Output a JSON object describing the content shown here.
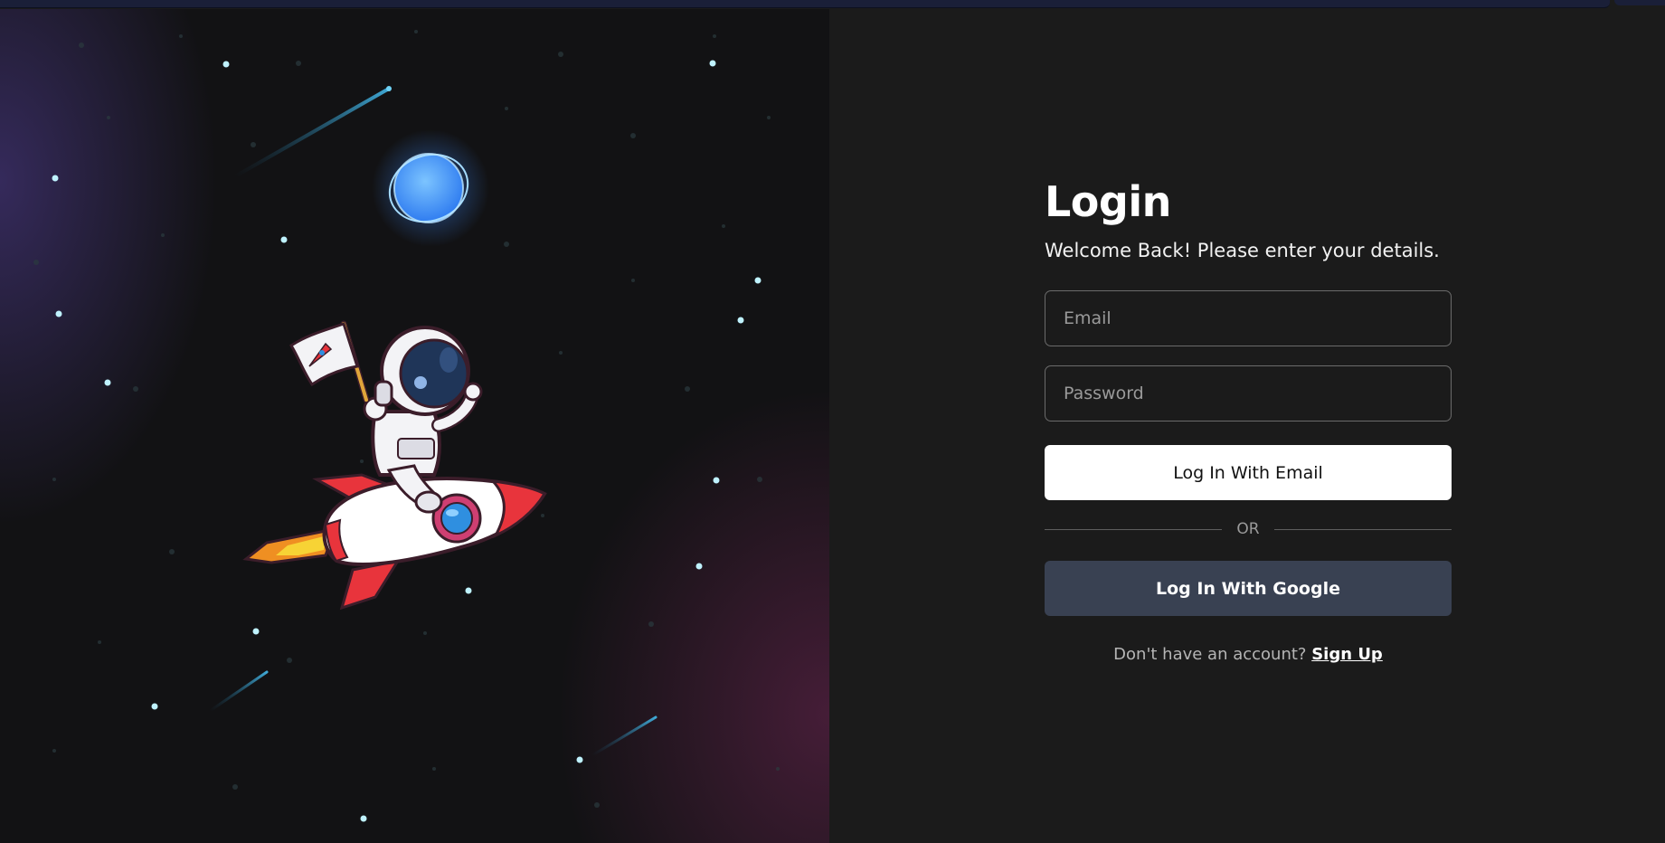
{
  "login": {
    "title": "Login",
    "subtitle": "Welcome Back! Please enter your details.",
    "email_placeholder": "Email",
    "password_placeholder": "Password",
    "email_button": "Log In With Email",
    "divider_text": "OR",
    "google_button": "Log In With Google",
    "signup_prompt": "Don't have an account?",
    "signup_link": "Sign Up"
  },
  "illustration": {
    "subject": "astronaut-on-rocket",
    "flag_icon": "rocket-icon",
    "planet": "blue-planet"
  },
  "colors": {
    "background": "#1b1b1b",
    "space_background": "#121214",
    "primary_button": "#ffffff",
    "google_button": "#394152",
    "rocket_red": "#e8343c",
    "planet_blue": "#4aa3ff"
  }
}
